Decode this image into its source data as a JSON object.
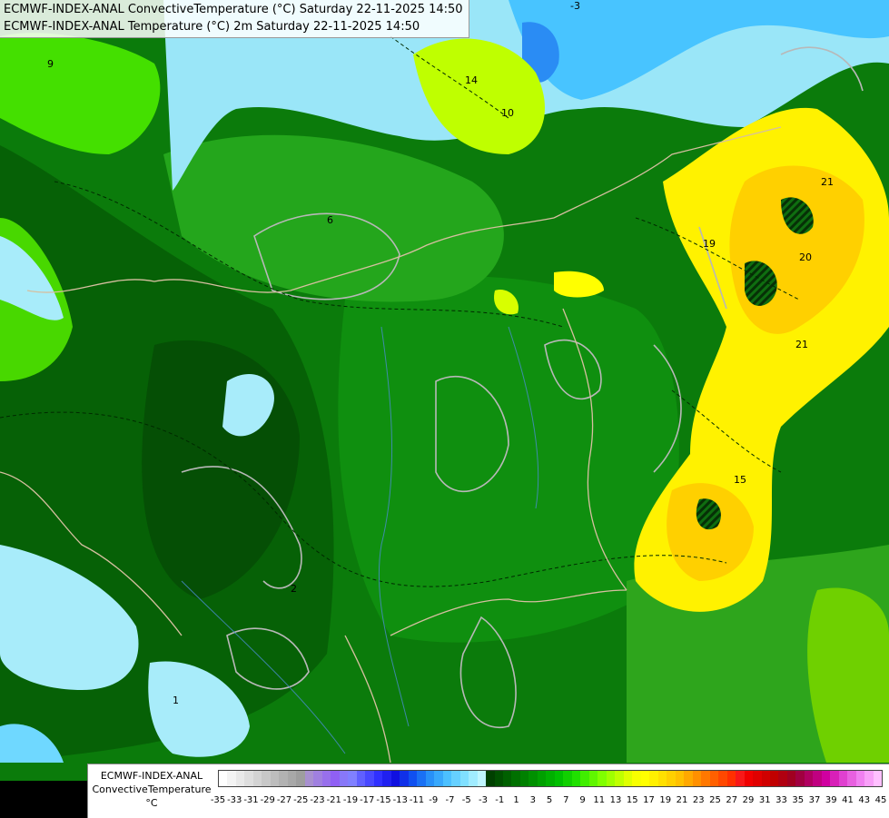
{
  "header": {
    "line1": "ECMWF-INDEX-ANAL ConvectiveTemperature (°C) Saturday 22-11-2025 14:50",
    "line2": "ECMWF-INDEX-ANAL Temperature (°C) 2m Saturday 22-11-2025 14:50"
  },
  "legend": {
    "model": "ECMWF-INDEX-ANAL",
    "parameter": "ConvectiveTemperature",
    "unit": "°C",
    "tick_labels": [
      "-35",
      "-33",
      "-31",
      "-29",
      "-27",
      "-25",
      "-23",
      "-21",
      "-19",
      "-17",
      "-15",
      "-13",
      "-11",
      "-9",
      "-7",
      "-5",
      "-3",
      "-1",
      "1",
      "3",
      "5",
      "7",
      "9",
      "11",
      "13",
      "15",
      "17",
      "19",
      "21",
      "23",
      "25",
      "27",
      "29",
      "31",
      "33",
      "35",
      "37",
      "39",
      "41",
      "43",
      "45"
    ],
    "colors": [
      "#ffffff",
      "#f4f4f4",
      "#e9e9e9",
      "#dedede",
      "#d3d3d3",
      "#c8c8c8",
      "#bdbdbd",
      "#b2b2b2",
      "#a8a8a8",
      "#9e9e9e",
      "#a890d0",
      "#a080e0",
      "#9870ec",
      "#9060f4",
      "#8878f8",
      "#8080ff",
      "#6060ff",
      "#4848ff",
      "#3030ff",
      "#2020f0",
      "#1010e0",
      "#1030e8",
      "#1050f0",
      "#1a70f4",
      "#2890f8",
      "#38a8fc",
      "#4cc0ff",
      "#66d0ff",
      "#80e0ff",
      "#a0ecff",
      "#c0f6ff",
      "#004000",
      "#005000",
      "#006000",
      "#007000",
      "#008000",
      "#009000",
      "#00a000",
      "#00b000",
      "#00c000",
      "#10d000",
      "#20e000",
      "#40ee00",
      "#60f600",
      "#80ff00",
      "#a0ff00",
      "#c0ff00",
      "#e0ff00",
      "#f8ff00",
      "#ffff00",
      "#fff000",
      "#ffe000",
      "#ffd000",
      "#ffc000",
      "#ffa800",
      "#ff9000",
      "#ff7800",
      "#ff6000",
      "#ff4800",
      "#ff3000",
      "#f81818",
      "#f00000",
      "#e00000",
      "#d00000",
      "#c00000",
      "#b00010",
      "#a00020",
      "#a00040",
      "#b00060",
      "#c00080",
      "#d000a0",
      "#d820b8",
      "#e040d0",
      "#e860e0",
      "#f080f0",
      "#f8a0f8",
      "#ffc0ff"
    ]
  },
  "map": {
    "contour_labels": [
      {
        "text": "-3",
        "lon": 628,
        "lat": 10
      },
      {
        "text": "14",
        "lon": 512,
        "lat": 92
      },
      {
        "text": "10",
        "lon": 552,
        "lat": 128
      },
      {
        "text": "21",
        "lon": 904,
        "lat": 204
      },
      {
        "text": "19",
        "lon": 774,
        "lat": 272
      },
      {
        "text": "20",
        "lon": 880,
        "lat": 287
      },
      {
        "text": "21",
        "lon": 876,
        "lat": 383
      },
      {
        "text": "15",
        "lon": 808,
        "lat": 532
      },
      {
        "text": "9",
        "lon": 52,
        "lat": 74
      },
      {
        "text": "6",
        "lon": 360,
        "lat": 246
      },
      {
        "text": "2",
        "lon": 320,
        "lat": 652
      },
      {
        "text": "1",
        "lon": 190,
        "lat": 775
      }
    ]
  }
}
